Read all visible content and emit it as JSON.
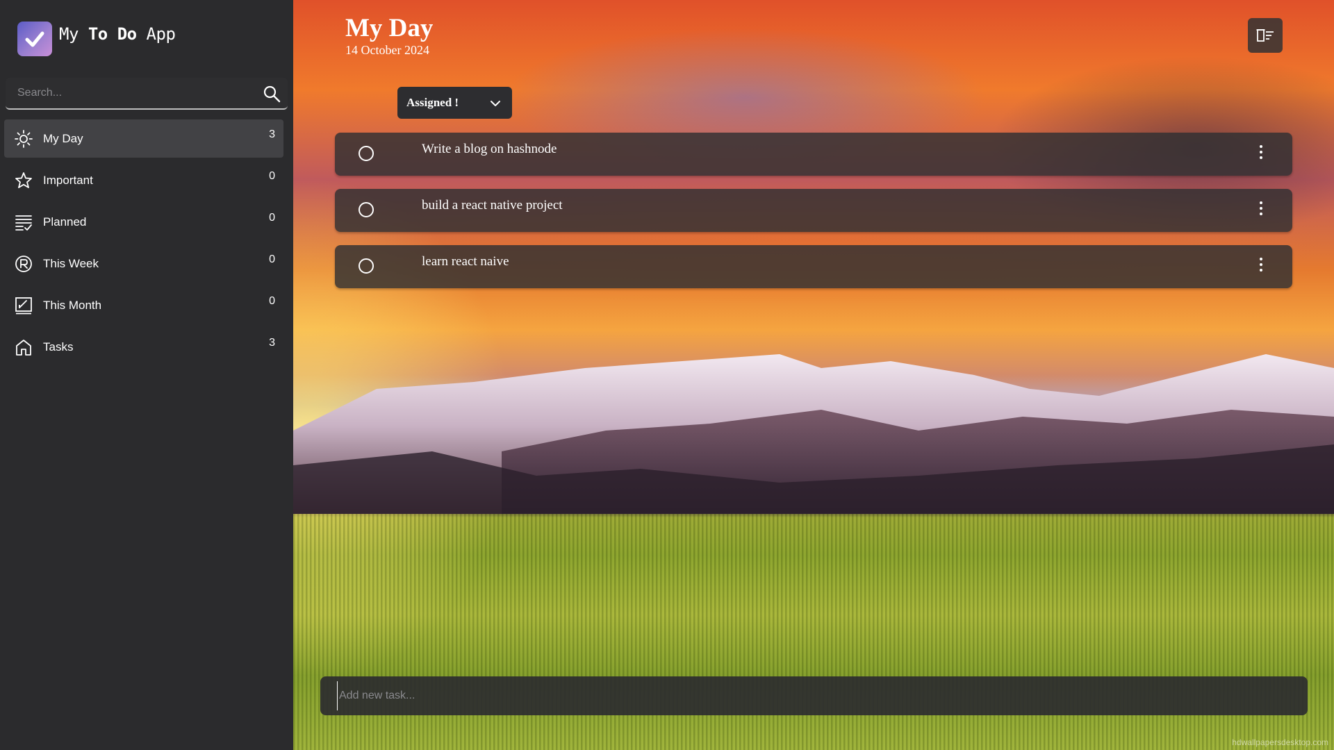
{
  "app": {
    "title_prefix": "My ",
    "title_bold": "To Do",
    "title_suffix": " App"
  },
  "search": {
    "placeholder": "Search..."
  },
  "sidebar": {
    "items": [
      {
        "label": "My Day",
        "count": "3",
        "icon": "sun-icon",
        "active": true
      },
      {
        "label": "Important",
        "count": "0",
        "icon": "star-icon",
        "active": false
      },
      {
        "label": "Planned",
        "count": "0",
        "icon": "planned-list-icon",
        "active": false
      },
      {
        "label": "This Week",
        "count": "0",
        "icon": "week-circle-icon",
        "active": false
      },
      {
        "label": "This Month",
        "count": "0",
        "icon": "month-edit-icon",
        "active": false
      },
      {
        "label": "Tasks",
        "count": "3",
        "icon": "home-icon",
        "active": false
      }
    ]
  },
  "header": {
    "title": "My Day",
    "date": "14 October 2024"
  },
  "filter": {
    "selected": "Assigned !"
  },
  "tasks": [
    {
      "text": "Write a blog on hashnode"
    },
    {
      "text": "build a react native project"
    },
    {
      "text": "learn react naive"
    }
  ],
  "add_task": {
    "placeholder": "Add new task..."
  },
  "watermark": "hdwallpapersdesktop.com",
  "colors": {
    "sidebar_bg": "#2b2b2d",
    "active_item_bg": "#424245",
    "task_bg": "#303032",
    "logo_gradient_start": "#5c5cc7",
    "logo_gradient_end": "#c98fd8"
  }
}
